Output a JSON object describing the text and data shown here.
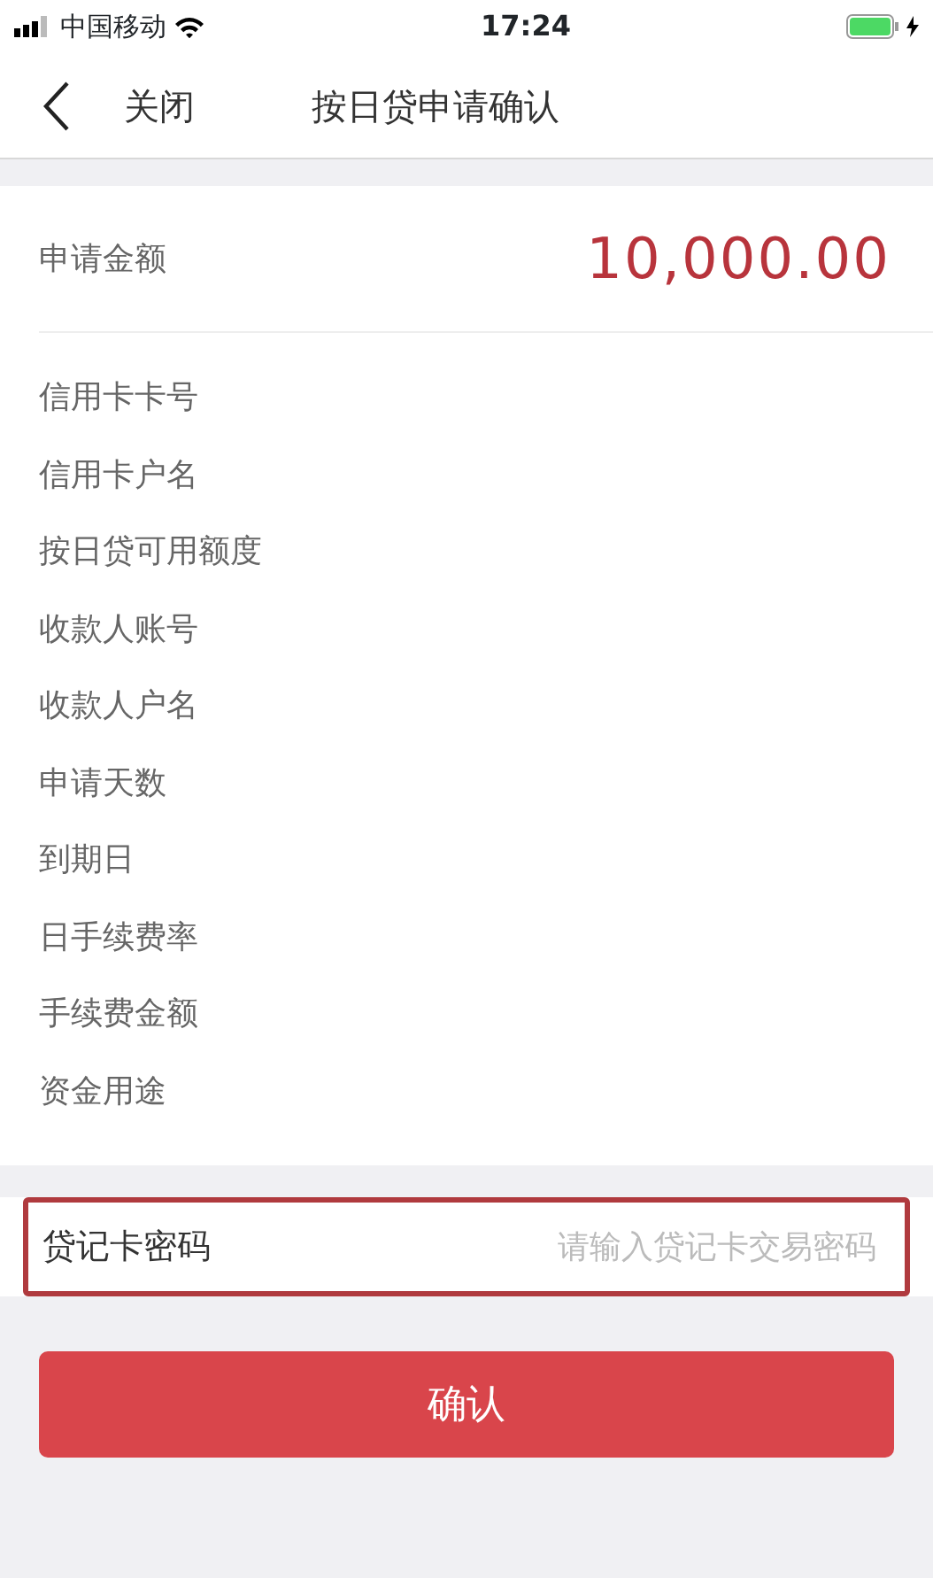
{
  "status_bar": {
    "carrier": "中国移动",
    "time": "17:24",
    "charging": true
  },
  "nav": {
    "back_label": "关闭",
    "title": "按日贷申请确认"
  },
  "amount": {
    "label": "申请金额",
    "value": "10,000.00"
  },
  "details": [
    {
      "label": "信用卡卡号"
    },
    {
      "label": "信用卡户名"
    },
    {
      "label": "按日贷可用额度"
    },
    {
      "label": "收款人账号"
    },
    {
      "label": "收款人户名"
    },
    {
      "label": "申请天数"
    },
    {
      "label": "到期日"
    },
    {
      "label": "日手续费率"
    },
    {
      "label": "手续费金额"
    },
    {
      "label": "资金用途"
    }
  ],
  "password": {
    "label": "贷记卡密码",
    "placeholder": "请输入贷记卡交易密码",
    "highlighted": true
  },
  "confirm_button": {
    "label": "确认"
  }
}
